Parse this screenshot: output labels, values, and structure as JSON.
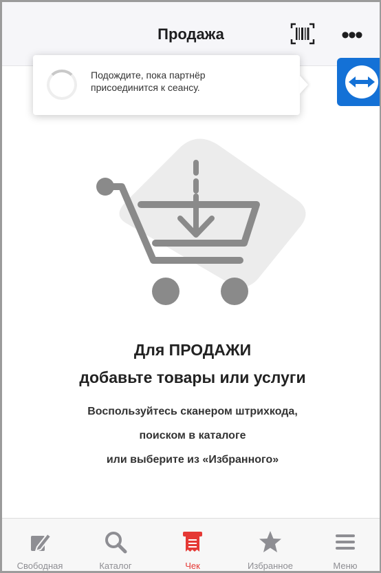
{
  "header": {
    "title": "Продажа",
    "barcode_icon": "barcode-scanner-icon",
    "more_icon": "more-dots-icon",
    "more_text": "•••"
  },
  "toast": {
    "message_line1": "Подождите, пока партнёр",
    "message_line2": "присоединится к сеансу.",
    "spinner_icon": "loading-spinner-icon"
  },
  "teamviewer": {
    "icon": "teamviewer-icon",
    "color": "#1471d6"
  },
  "empty_state": {
    "illustration_icon": "cart-download-icon",
    "headline_line1": "Для ПРОДАЖИ",
    "headline_line2": "добавьте товары или услуги",
    "hint_line1": "Воспользуйтесь сканером штрихкода,",
    "hint_line2": "поиском в каталоге",
    "hint_line3": "или выберите из «Избранного»"
  },
  "tabbar": {
    "active_color": "#e53935",
    "inactive_color": "#8e8e93",
    "items": [
      {
        "label": "Свободная",
        "icon": "free-price-edit-icon",
        "active": false
      },
      {
        "label": "Каталог",
        "icon": "search-icon",
        "active": false
      },
      {
        "label": "Чек",
        "icon": "receipt-icon",
        "active": true
      },
      {
        "label": "Избранное",
        "icon": "star-icon",
        "active": false
      },
      {
        "label": "Меню",
        "icon": "hamburger-menu-icon",
        "active": false
      }
    ]
  }
}
